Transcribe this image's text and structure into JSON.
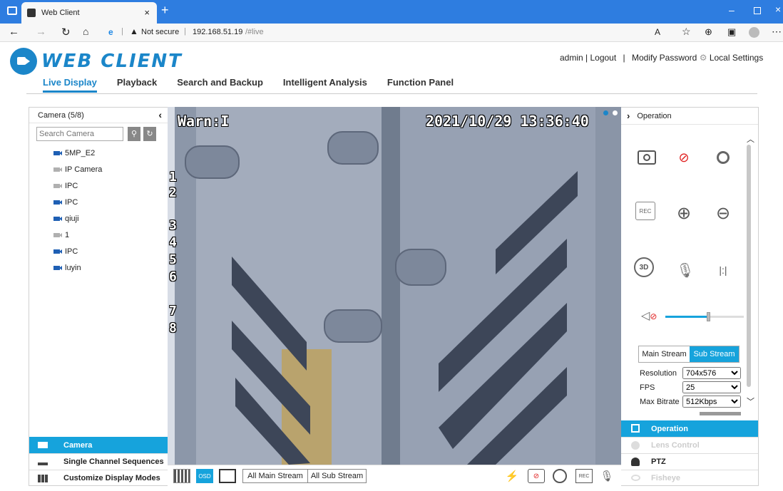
{
  "browser": {
    "tab_title": "Web Client",
    "security_label": "Not secure",
    "url_host": "192.168.51.19",
    "url_path": "/#live"
  },
  "header": {
    "logo_text": "WEB CLIENT",
    "user": "admin",
    "logout": "Logout",
    "modify_password": "Modify Password",
    "local_settings": "Local Settings"
  },
  "nav": {
    "live": "Live Display",
    "playback": "Playback",
    "search": "Search and Backup",
    "intelligent": "Intelligent Analysis",
    "function": "Function Panel"
  },
  "left": {
    "header": "Camera (5/8)",
    "search_placeholder": "Search Camera",
    "cameras": [
      {
        "name": "5MP_E2",
        "color": "#1e5fb4"
      },
      {
        "name": "IP Camera",
        "color": "#b0b0b0"
      },
      {
        "name": "IPC",
        "color": "#b0b0b0"
      },
      {
        "name": "IPC",
        "color": "#1e5fb4"
      },
      {
        "name": "qiuji",
        "color": "#1e5fb4"
      },
      {
        "name": "1",
        "color": "#b0b0b0"
      },
      {
        "name": "IPC",
        "color": "#1e5fb4"
      },
      {
        "name": "luyin",
        "color": "#1e5fb4"
      }
    ],
    "bottom": {
      "camera": "Camera",
      "sequences": "Single Channel Sequences",
      "display_modes": "Customize Display Modes"
    }
  },
  "video": {
    "osd_warn": "Warn:I",
    "osd_datetime": "2021/10/29 13:36:40",
    "osd_digits": [
      "1",
      "2",
      "3",
      "4",
      "5",
      "6",
      "7",
      "8"
    ]
  },
  "toolbar": {
    "osd": "OSD",
    "all_main": "All Main Stream",
    "all_sub": "All Sub Stream",
    "rec": "REC"
  },
  "right": {
    "header": "Operation",
    "rec": "REC",
    "three_d": "3D",
    "stream_main": "Main Stream",
    "stream_sub": "Sub Stream",
    "resolution_label": "Resolution",
    "resolution_value": "704x576",
    "fps_label": "FPS",
    "fps_value": "25",
    "bitrate_label": "Max Bitrate",
    "bitrate_value": "512Kbps",
    "volume_level": 0.55,
    "tabs": {
      "operation": "Operation",
      "lens": "Lens Control",
      "ptz": "PTZ",
      "fisheye": "Fisheye"
    }
  },
  "colors": {
    "accent": "#16a3dc",
    "nav_active": "#1b86c9",
    "browser_blue": "#2e7de0"
  }
}
